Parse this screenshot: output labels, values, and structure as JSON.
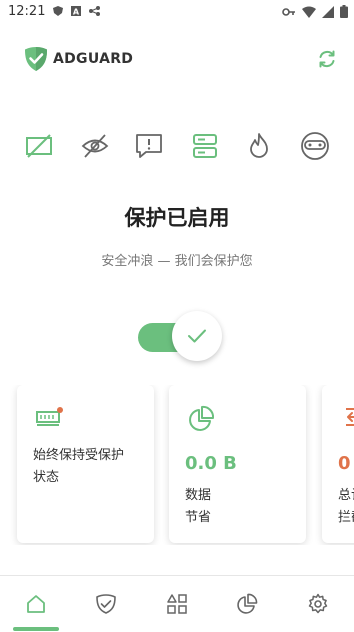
{
  "status_bar": {
    "time": "12:21"
  },
  "header": {
    "brand": "ADGUARD"
  },
  "features": [
    "ad-block-icon",
    "tracking-protection-icon",
    "annoyances-icon",
    "dns-icon",
    "firewall-icon",
    "stealth-icon"
  ],
  "protection": {
    "title": "保护已启用",
    "subtitle": "安全冲浪 — 我们会保护您",
    "enabled": true
  },
  "cards": [
    {
      "line1": "始终保持受保护",
      "line2": "状态"
    },
    {
      "value": "0.0 B",
      "line1": "数据",
      "line2": "节省"
    },
    {
      "value": "0",
      "line1": "总计",
      "line2": "拦截"
    }
  ],
  "nav": [
    "home",
    "protection",
    "apps",
    "statistics",
    "settings"
  ],
  "colors": {
    "accent": "#6bbf7e",
    "warning": "#e0734a"
  }
}
